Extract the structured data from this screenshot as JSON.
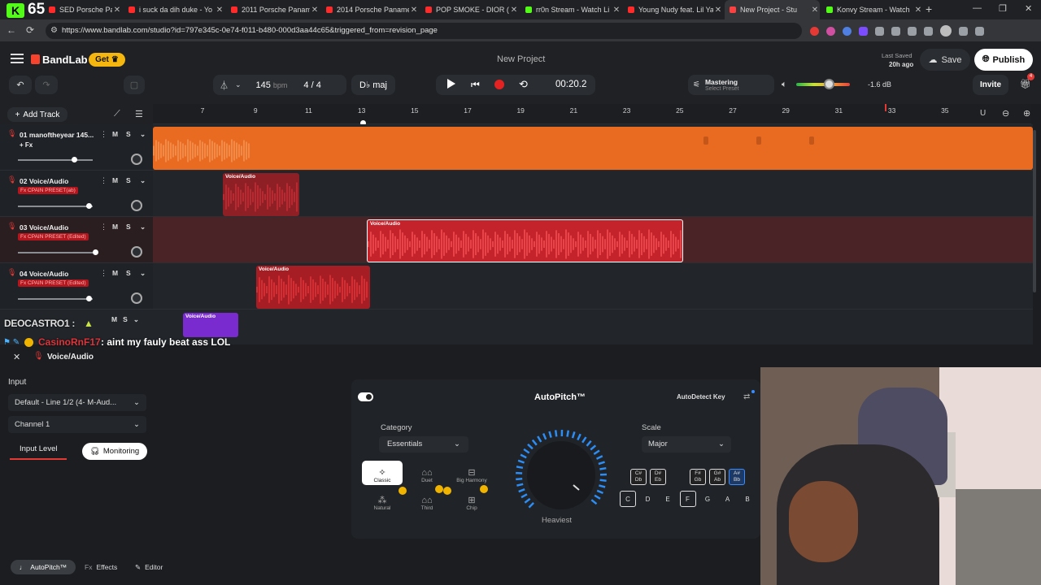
{
  "browser": {
    "tabs": [
      {
        "label": "SED Porsche Panamera",
        "fav_color": "#ff2a2a"
      },
      {
        "label": "i suck da dih duke - Yo",
        "fav_color": "#ff2a2a"
      },
      {
        "label": "2011 Porsche Panamera",
        "fav_color": "#ff2a2a"
      },
      {
        "label": "2014 Porsche Panamera",
        "fav_color": "#ff2a2a"
      },
      {
        "label": "POP SMOKE - DIOR (O",
        "fav_color": "#ff2a2a"
      },
      {
        "label": "rr0n Stream - Watch Li",
        "fav_color": "#53fc18"
      },
      {
        "label": "Young Nudy feat. Lil Ya",
        "fav_color": "#ff2a2a"
      },
      {
        "label": "New Project - Stu",
        "fav_color": "#ff4040"
      },
      {
        "label": "Konvy Stream - Watch",
        "fav_color": "#53fc18"
      }
    ],
    "url": "https://www.bandlab.com/studio?id=797e345c-0e74-f011-b480-000d3aa44c65&triggered_from=revision_page",
    "counter": "65"
  },
  "header": {
    "brand": "BandLab",
    "get_label": "Get",
    "project_title": "New Project",
    "last_saved_label": "Last Saved",
    "last_saved_time": "20h ago",
    "save_label": "Save",
    "publish_label": "Publish",
    "invite_label": "Invite",
    "notif_count": "4"
  },
  "transport": {
    "bpm": "145",
    "bpm_unit": "bpm",
    "time_sig": "4 / 4",
    "key": "D♭ maj",
    "time": "00:20.2",
    "mastering_label": "Mastering",
    "mastering_sub": "Select Preset",
    "volume_db": "-1.6 dB",
    "volume_level": 0.6
  },
  "toolbar": {
    "add_track": "Add Track"
  },
  "ruler": {
    "bars": [
      "7",
      "9",
      "11",
      "13",
      "15",
      "17",
      "19",
      "21",
      "23",
      "25",
      "27",
      "29",
      "31",
      "33",
      "35"
    ]
  },
  "tracks": [
    {
      "name": "01  manoftheyear 145...",
      "fx": "+ Fx"
    },
    {
      "name": "02  Voice/Audio",
      "fx": "Fx CPAIN PRESET(ab)"
    },
    {
      "name": "03  Voice/Audio",
      "fx": "Fx CPAIN PRESET (Edited)"
    },
    {
      "name": "04  Voice/Audio",
      "fx": "Fx CPAIN PRESET (Edited)"
    }
  ],
  "clip_label": "Voice/Audio",
  "chat": {
    "user1": "DEOCASTRO1 :",
    "user2": "CasinoRnF17",
    "msg2": ": aint my fauly beat ass LOL"
  },
  "panel": {
    "track_title": "Voice/Audio",
    "input_label": "Input",
    "input_device": "Default - Line 1/2 (4- M-Aud...",
    "channel": "Channel 1",
    "input_level": "Input Level",
    "monitoring": "Monitoring"
  },
  "autopitch": {
    "title": "AutoPitch™",
    "autodetect": "AutoDetect Key",
    "category_label": "Category",
    "category_value": "Essentials",
    "scale_label": "Scale",
    "scale_value": "Major",
    "knob_label": "Heaviest",
    "categories": [
      "Classic",
      "Duet",
      "Big Harmony",
      "Natural",
      "Third",
      "Chip"
    ],
    "sharp_keys": [
      "C#\nDb",
      "D#\nEb",
      "F#\nGb",
      "G#\nAb",
      "A#\nBb"
    ],
    "keys": [
      "C",
      "D",
      "E",
      "F",
      "G",
      "A",
      "B"
    ]
  },
  "bottom_tabs": {
    "autopitch": "AutoPitch™",
    "effects": "Effects",
    "editor": "Editor"
  }
}
